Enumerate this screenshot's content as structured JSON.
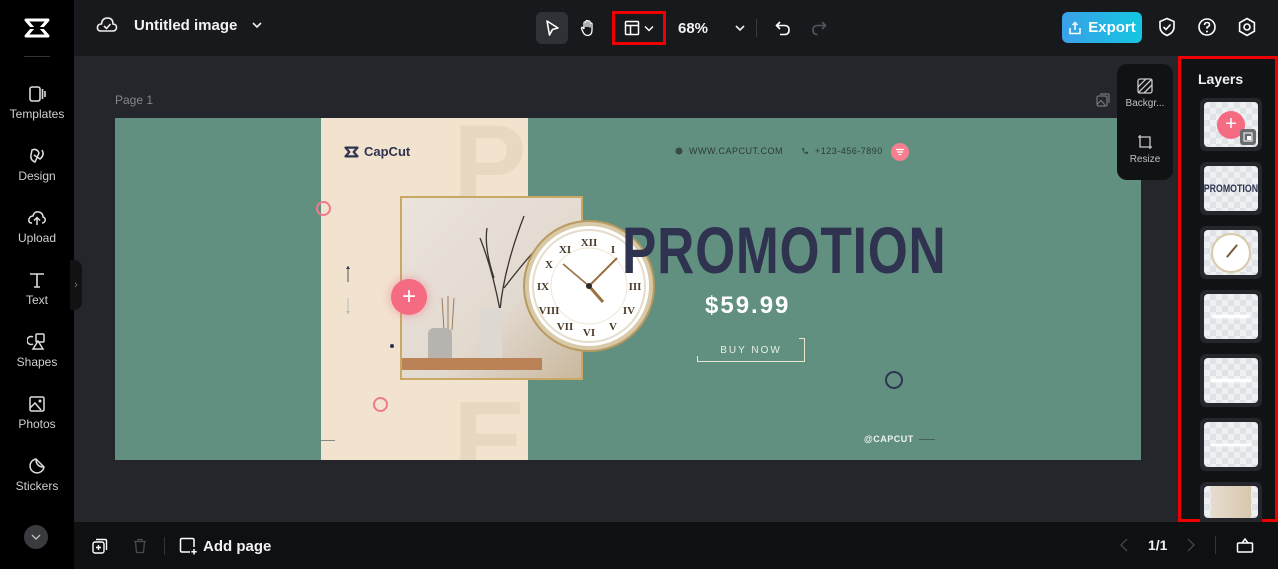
{
  "app": {
    "title": "Untitled image"
  },
  "toolbar": {
    "zoom": "68%",
    "export_label": "Export"
  },
  "sidebar": {
    "items": [
      {
        "label": "Templates",
        "icon": "templates-icon"
      },
      {
        "label": "Design",
        "icon": "design-icon"
      },
      {
        "label": "Upload",
        "icon": "upload-icon"
      },
      {
        "label": "Text",
        "icon": "text-icon"
      },
      {
        "label": "Shapes",
        "icon": "shapes-icon"
      },
      {
        "label": "Photos",
        "icon": "photos-icon"
      },
      {
        "label": "Stickers",
        "icon": "stickers-icon"
      }
    ]
  },
  "canvas": {
    "page_label": "Page 1",
    "float_panel": {
      "background_label": "Backgr...",
      "resize_label": "Resize"
    }
  },
  "design": {
    "brand": "CapCut",
    "website": "WWW.CAPCUT.COM",
    "phone": "+123-456-7890",
    "headline": "PROMOTION",
    "price": "$59.99",
    "cta": "BUY NOW",
    "handle": "@CAPCUT",
    "watermark_top": "P",
    "watermark_bottom": "E",
    "colors": {
      "background": "#619080",
      "cream": "#f2e3cf",
      "headline": "#2f3350",
      "accent_pink": "#f56b82"
    }
  },
  "layers": {
    "title": "Layers",
    "items": [
      {
        "name": "plus-button-layer"
      },
      {
        "name": "promotion-text-layer",
        "text": "PROMOTION"
      },
      {
        "name": "clock-layer"
      },
      {
        "name": "line-layer-1"
      },
      {
        "name": "line-layer-2"
      },
      {
        "name": "line-layer-3"
      },
      {
        "name": "photo-layer"
      }
    ]
  },
  "bottom": {
    "add_page_label": "Add page",
    "page_indicator": "1/1"
  }
}
